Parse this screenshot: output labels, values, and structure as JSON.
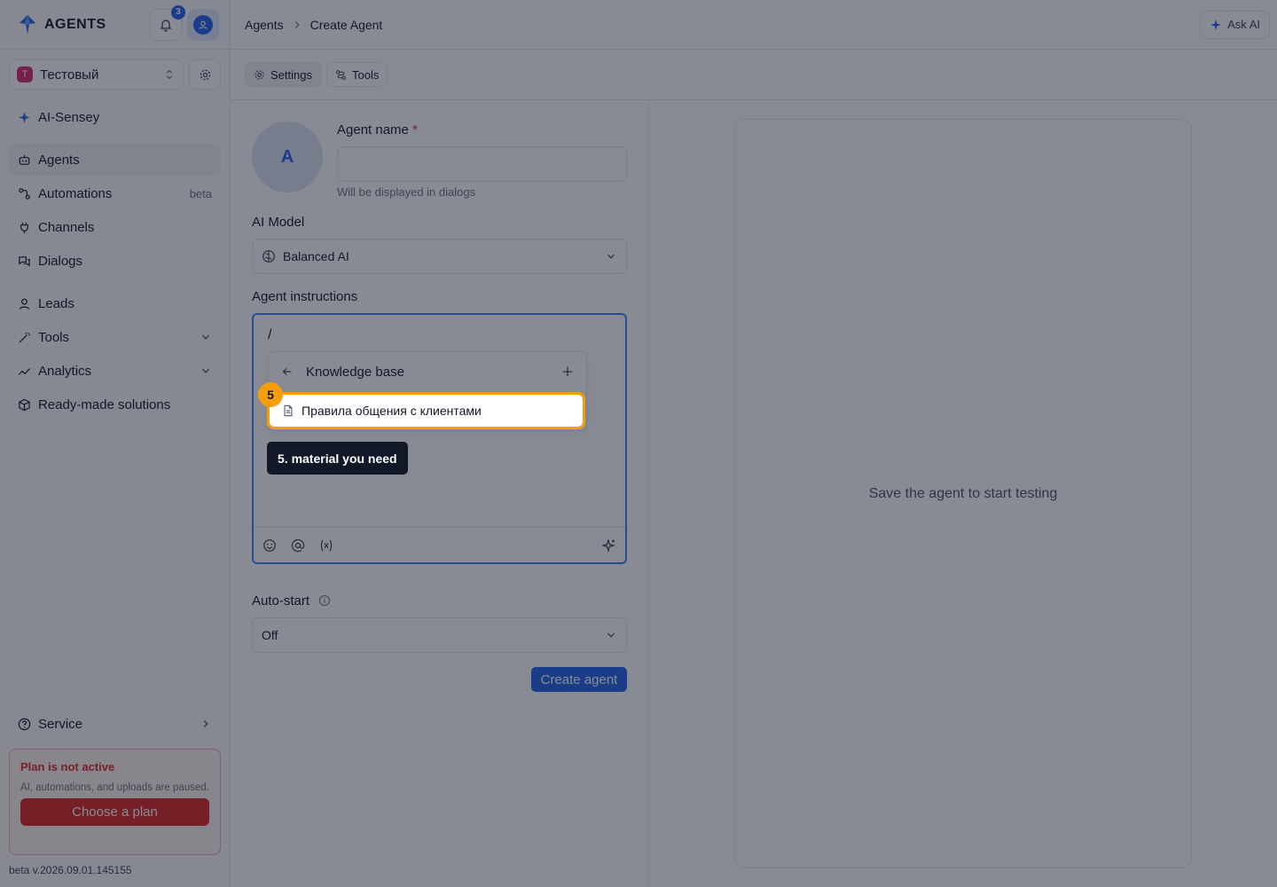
{
  "app": {
    "logo_text": "AGENTS",
    "notifications_count": "3"
  },
  "workspace": {
    "badge": "Т",
    "name": "Тестовый"
  },
  "sidebar": {
    "brand_item": "AI-Sensey",
    "items": [
      {
        "label": "Agents",
        "icon": "robot-icon",
        "active": true
      },
      {
        "label": "Automations",
        "icon": "workflow-icon",
        "suffix": "beta"
      },
      {
        "label": "Channels",
        "icon": "plug-icon"
      },
      {
        "label": "Dialogs",
        "icon": "chat-icon"
      },
      {
        "label": "Leads",
        "icon": "user-icon"
      },
      {
        "label": "Tools",
        "icon": "wand-icon",
        "expandable": true
      },
      {
        "label": "Analytics",
        "icon": "chart-icon",
        "expandable": true
      },
      {
        "label": "Ready-made solutions",
        "icon": "box-icon"
      }
    ],
    "service_label": "Service",
    "plan": {
      "title": "Plan is not active",
      "description": "AI, automations, and uploads are paused.",
      "button": "Choose a plan"
    },
    "version": "beta v.2026.09.01.145155"
  },
  "header": {
    "breadcrumb": [
      "Agents",
      "Create Agent"
    ],
    "ask_ai": "Ask AI"
  },
  "tabs": [
    {
      "label": "Settings",
      "icon": "gear-icon",
      "active": true
    },
    {
      "label": "Tools",
      "icon": "tools-icon"
    }
  ],
  "form": {
    "avatar_letter": "A",
    "agent_name_label": "Agent name",
    "required_mark": "*",
    "agent_name_value": "",
    "agent_name_hint": "Will be displayed in dialogs",
    "ai_model_label": "AI Model",
    "ai_model_value": "Balanced AI",
    "instructions_label": "Agent instructions",
    "instructions_value": "/",
    "autostart_label": "Auto-start",
    "autostart_value": "Off",
    "create_button": "Create agent"
  },
  "slash_menu": {
    "title": "Knowledge base",
    "items": [
      "Правила общения с клиентами"
    ]
  },
  "preview": {
    "message": "Save the agent to start testing"
  },
  "tour": {
    "step": "5",
    "tooltip": "5. material you need"
  },
  "colors": {
    "accent": "#2563eb",
    "highlight": "#f59e0b",
    "danger": "#dc2626",
    "overlay": "#111827"
  }
}
